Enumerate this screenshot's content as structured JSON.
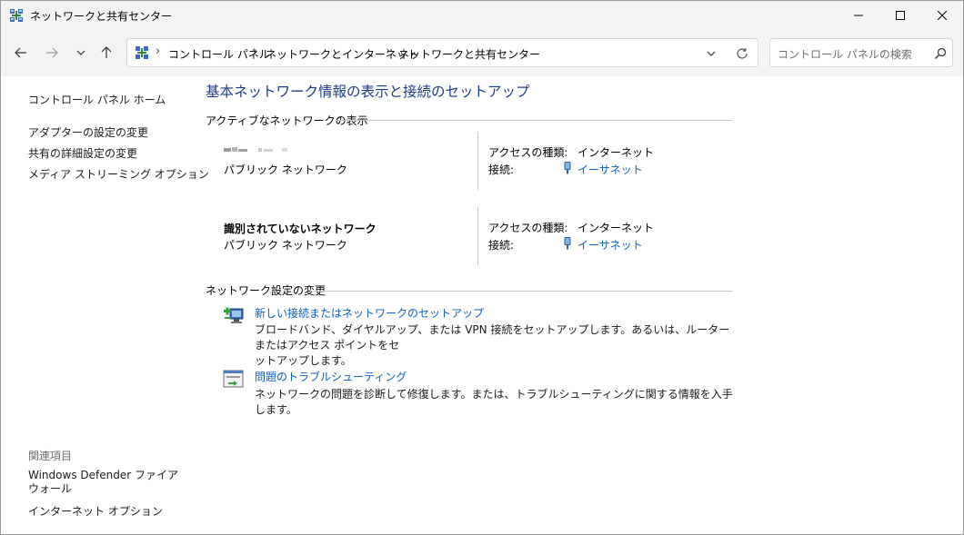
{
  "window": {
    "title": "ネットワークと共有センター",
    "icon": "network-center-icon",
    "controls": [
      "minimize-icon",
      "maximize-icon",
      "close-icon"
    ]
  },
  "nav": {
    "back": "arrow-left-icon",
    "forward": "arrow-right-icon",
    "recent": "chevron-down-icon",
    "up": "arrow-up-icon"
  },
  "address": {
    "breadcrumb": [
      "コントロール パネル",
      "ネットワークとインターネット",
      "ネットワークと共有センター"
    ],
    "separator": "›"
  },
  "search": {
    "placeholder": "コントロール パネルの検索"
  },
  "sidebar": {
    "home": "コントロール パネル ホーム",
    "links": [
      "アダプターの設定の変更",
      "共有の詳細設定の変更",
      "メディア ストリーミング オプション"
    ],
    "related_heading": "関連項目",
    "related": [
      "Windows Defender ファイアウォール",
      "インターネット オプション"
    ]
  },
  "main": {
    "title": "基本ネットワーク情報の表示と接続のセットアップ",
    "active_heading": "アクティブなネットワークの表示",
    "networks": [
      {
        "name": "",
        "name_redacted": true,
        "type": "パブリック ネットワーク",
        "access_label": "アクセスの種類:",
        "access_value": "インターネット",
        "conn_label": "接続:",
        "conn_value": "イーサネット"
      },
      {
        "name": "識別されていないネットワーク",
        "type": "パブリック ネットワーク",
        "access_label": "アクセスの種類:",
        "access_value": "インターネット",
        "conn_label": "接続:",
        "conn_value": "イーサネット"
      }
    ],
    "change_heading": "ネットワーク設定の変更",
    "tasks": [
      {
        "icon": "new-connection-icon",
        "link": "新しい接続またはネットワークのセットアップ",
        "desc_line1": "ブロードバンド、ダイヤルアップ、または VPN 接続をセットアップします。あるいは、ルーターまたはアクセス ポイントをセ",
        "desc_line2": "ットアップします。"
      },
      {
        "icon": "troubleshoot-icon",
        "link": "問題のトラブルシューティング",
        "desc_line1": "ネットワークの問題を診断して修復します。または、トラブルシューティングに関する情報を入手します。",
        "desc_line2": ""
      }
    ]
  },
  "colors": {
    "title_blue": "#1c3d8a",
    "link_blue": "#0a5fc4",
    "chrome": "#f3f3f3",
    "divider": "#c8c8c8"
  }
}
